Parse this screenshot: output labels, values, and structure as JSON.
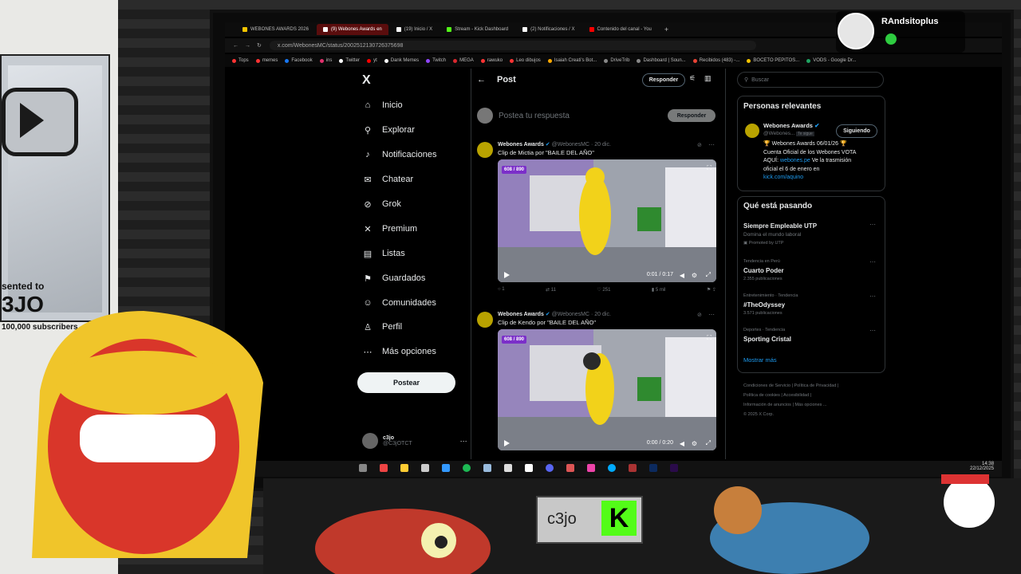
{
  "browser": {
    "tabs": [
      {
        "label": "WEBONES AWARDS 2026",
        "active": false,
        "color": "#f5c400"
      },
      {
        "label": "(9) Webones Awards en",
        "active": true,
        "color": "#ffffff"
      },
      {
        "label": "(19) Inicio / X",
        "active": false,
        "color": "#ffffff"
      },
      {
        "label": "Stream - Kick Dashboard",
        "active": false,
        "color": "#53fc18"
      },
      {
        "label": "(2) Notificaciones / X",
        "active": false,
        "color": "#ffffff"
      },
      {
        "label": "Contenido del canal - You",
        "active": false,
        "color": "#ff0000"
      }
    ],
    "url": "x.com/WebonesMC/status/2002512130726375698",
    "bookmarks": [
      {
        "label": "Tops",
        "color": "#ff3333"
      },
      {
        "label": "memes",
        "color": "#ff3333"
      },
      {
        "label": "Facebook",
        "color": "#1877f2"
      },
      {
        "label": "ins",
        "color": "#e1306c"
      },
      {
        "label": "Twitter",
        "color": "#ffffff"
      },
      {
        "label": "yt",
        "color": "#ff0000"
      },
      {
        "label": "Dank Memes",
        "color": "#ffffff"
      },
      {
        "label": "Twitch",
        "color": "#9146ff"
      },
      {
        "label": "MEGA",
        "color": "#d9272e"
      },
      {
        "label": "rawuko",
        "color": "#ff3333"
      },
      {
        "label": "Leo dibujos",
        "color": "#ff3333"
      },
      {
        "label": "Isaiah Creati's Bot...",
        "color": "#ffaa00"
      },
      {
        "label": "DriveTrib",
        "color": "#888888"
      },
      {
        "label": "Dashboard | Soun...",
        "color": "#888888"
      },
      {
        "label": "Recibidos (483) -...",
        "color": "#ea4335"
      },
      {
        "label": "BOCETO PEPITOS...",
        "color": "#f5c400"
      },
      {
        "label": "VODS - Google Dr...",
        "color": "#1fa463"
      }
    ]
  },
  "sidebar": {
    "logo": "X",
    "items": [
      {
        "label": "Inicio",
        "icon": "⌂"
      },
      {
        "label": "Explorar",
        "icon": "⚲"
      },
      {
        "label": "Notificaciones",
        "icon": "🔔"
      },
      {
        "label": "Chatear",
        "icon": "✉"
      },
      {
        "label": "Grok",
        "icon": "⊘"
      },
      {
        "label": "Premium",
        "icon": "X"
      },
      {
        "label": "Listas",
        "icon": "▤"
      },
      {
        "label": "Guardados",
        "icon": "⚑"
      },
      {
        "label": "Comunidades",
        "icon": "👥"
      },
      {
        "label": "Perfil",
        "icon": "👤"
      },
      {
        "label": "Más opciones",
        "icon": "⋯"
      }
    ],
    "post_button": "Postear",
    "account_name": "c3jo",
    "account_handle": "@C3jOTCT"
  },
  "main": {
    "header_title": "Post",
    "reply_chip": "Responder",
    "compose_placeholder": "Postea tu respuesta",
    "compose_button": "Responder",
    "tweets": [
      {
        "author": "Webones Awards",
        "handle": "@WebonesMC · 20 dic.",
        "text": "Clip de Mictia por \"BAILE DEL AÑO\"",
        "badge": "608 / 890",
        "time": "0:01 / 0:17",
        "replies": "1",
        "retweets": "11",
        "likes": "251",
        "views": "5 mil"
      },
      {
        "author": "Webones Awards",
        "handle": "@WebonesMC · 20 dic.",
        "text": "Clip de Kendo por \"BAILE DEL AÑO\"",
        "badge": "608 / 890",
        "time": "0:00 / 0:20",
        "replies": "",
        "retweets": "",
        "likes": "",
        "views": ""
      }
    ]
  },
  "right": {
    "search_placeholder": "Buscar",
    "relevant_title": "Personas relevantes",
    "relevant_name": "Webones Awards",
    "relevant_handle": "@Webones...",
    "relevant_follows_you": "Te sigue",
    "follow_button": "Siguiendo",
    "relevant_bio_1": "🏆 Webones Awards 06/01/26 🏆",
    "relevant_bio_2": "Cuenta Oficial de los Webones VOTA",
    "relevant_bio_3a": "AQUÍ: ",
    "relevant_bio_3b": "webones.pe",
    "relevant_bio_3c": " Ve la trasmisión",
    "relevant_bio_4": "oficial el 6 de enero en",
    "relevant_bio_5": "kick.com/aquino",
    "trends_title": "Qué está pasando",
    "trends": [
      {
        "context": "",
        "title": "Siempre Empleable UTP",
        "sub": "Domina el mundo laboral",
        "extra": "Promoted by UTP"
      },
      {
        "context": "Tendencia en Perú",
        "title": "Cuarto Poder",
        "sub": "2.355 publicaciones",
        "extra": ""
      },
      {
        "context": "Entretenimiento · Tendencia",
        "title": "#TheOdyssey",
        "sub": "3.571 publicaciones",
        "extra": ""
      },
      {
        "context": "Deportes · Tendencia",
        "title": "Sporting Cristal",
        "sub": "",
        "extra": ""
      }
    ],
    "show_more": "Mostrar más",
    "footer": [
      "Condiciones de Servicio",
      "Política de Privacidad",
      "Política de cookies",
      "Accesibilidad",
      "Información de anuncios",
      "Más opciones ...",
      "© 2025 X Corp."
    ]
  },
  "taskbar": {
    "time": "14:38",
    "date": "22/12/2025"
  },
  "overlay": {
    "username": "RAndsitoplus",
    "brand_name": "c3jo",
    "brand_k": "K",
    "plaque_presented": "sented to",
    "plaque_name": "3JO",
    "plaque_subs": "100,000 subscribers"
  },
  "colors": {
    "accent_blue": "#1d9bf0",
    "kick_green": "#53fc18",
    "video_badge": "#7b2fc9"
  }
}
